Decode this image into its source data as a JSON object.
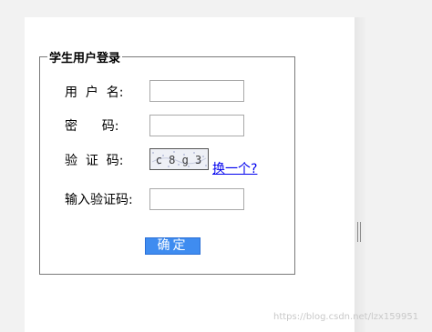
{
  "form": {
    "legend": "学生用户登录",
    "username_label": "用  户  名:",
    "password_label": "密      码:",
    "captcha_label": "验  证  码:",
    "captcha_input_label": "输入验证码:",
    "username_value": "",
    "password_value": "",
    "captcha_value": "",
    "captcha_image_text": "c 8 g 3",
    "refresh_link": "换一个?",
    "submit_label": "确定"
  },
  "watermark": "https://blog.csdn.net/lzx159951",
  "colors": {
    "submit_bg": "#3f8cf0",
    "link": "#0000ee",
    "border": "#7a7a7a"
  }
}
